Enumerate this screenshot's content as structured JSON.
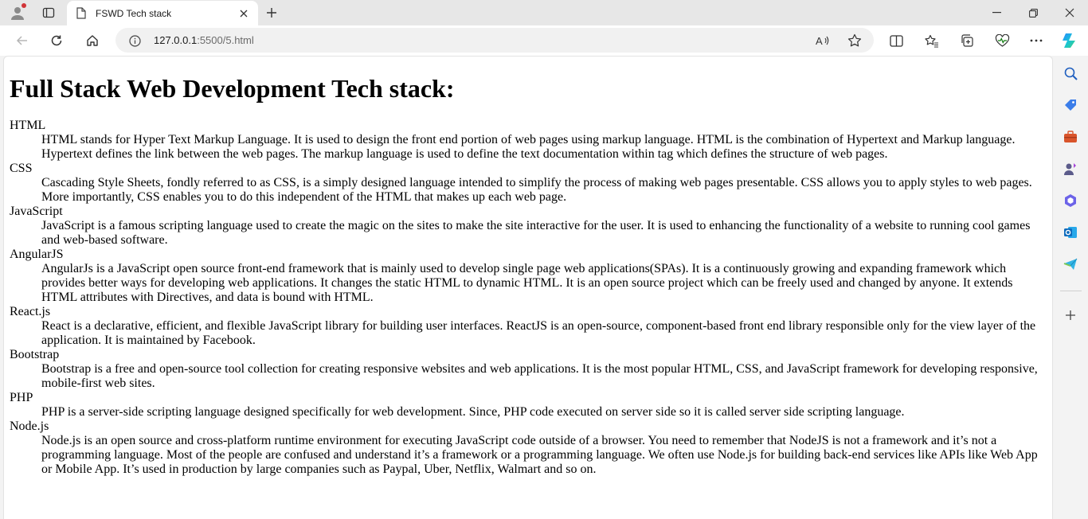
{
  "browser": {
    "tab_title": "FSWD Tech stack",
    "url_host": "127.0.0.1",
    "url_rest": ":5500/5.html"
  },
  "icons": {
    "profile": "profile-icon",
    "tab_actions": "tab-actions-icon",
    "favicon": "page-icon",
    "close": "close-icon",
    "new_tab": "plus-icon",
    "minimize": "minimize-icon",
    "restore": "restore-icon",
    "window_close": "close-icon",
    "back": "arrow-left-icon",
    "refresh": "refresh-icon",
    "home": "home-icon",
    "site_info": "info-icon",
    "read_aloud": "read-aloud-icon",
    "favorite": "star-icon",
    "split_screen": "split-screen-icon",
    "favorites": "favorites-icon",
    "collections": "collections-icon",
    "browser_essentials": "heart-pulse-icon",
    "more": "ellipsis-icon",
    "copilot": "copilot-icon"
  },
  "page": {
    "heading": "Full Stack Web Development Tech stack:",
    "items": [
      {
        "term": "HTML",
        "desc": "HTML stands for Hyper Text Markup Language. It is used to design the front end portion of web pages using markup language. HTML is the combination of Hypertext and Markup language. Hypertext defines the link between the web pages. The markup language is used to define the text documentation within tag which defines the structure of web pages."
      },
      {
        "term": "CSS",
        "desc": "Cascading Style Sheets, fondly referred to as CSS, is a simply designed language intended to simplify the process of making web pages presentable. CSS allows you to apply styles to web pages. More importantly, CSS enables you to do this independent of the HTML that makes up each web page."
      },
      {
        "term": "JavaScript",
        "desc": "JavaScript is a famous scripting language used to create the magic on the sites to make the site interactive for the user. It is used to enhancing the functionality of a website to running cool games and web-based software."
      },
      {
        "term": "AngularJS",
        "desc": "AngularJs is a JavaScript open source front-end framework that is mainly used to develop single page web applications(SPAs). It is a continuously growing and expanding framework which provides better ways for developing web applications. It changes the static HTML to dynamic HTML. It is an open source project which can be freely used and changed by anyone. It extends HTML attributes with Directives, and data is bound with HTML."
      },
      {
        "term": "React.js",
        "desc": "React is a declarative, efficient, and flexible JavaScript library for building user interfaces. ReactJS is an open-source, component-based front end library responsible only for the view layer of the application. It is maintained by Facebook."
      },
      {
        "term": "Bootstrap",
        "desc": "Bootstrap is a free and open-source tool collection for creating responsive websites and web applications. It is the most popular HTML, CSS, and JavaScript framework for developing responsive, mobile-first web sites."
      },
      {
        "term": "PHP",
        "desc": "PHP is a server-side scripting language designed specifically for web development. Since, PHP code executed on server side so it is called server side scripting language."
      },
      {
        "term": "Node.js",
        "desc": "Node.js is an open source and cross-platform runtime environment for executing JavaScript code outside of a browser. You need to remember that NodeJS is not a framework and it’s not a programming language. Most of the people are confused and understand it’s a framework or a programming language. We often use Node.js for building back-end services like APIs like Web App or Mobile App. It’s used in production by large companies such as Paypal, Uber, Netflix, Walmart and so on."
      }
    ]
  }
}
